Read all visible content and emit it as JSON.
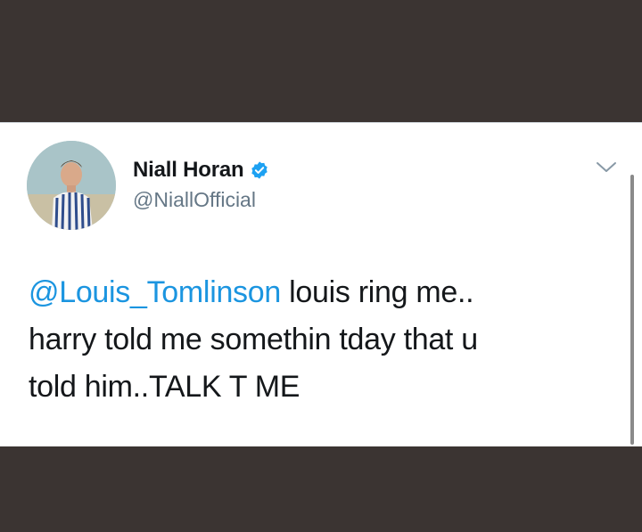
{
  "user": {
    "display_name": "Niall Horan",
    "handle": "@NiallOfficial",
    "verified": true
  },
  "tweet": {
    "mention": "@Louis_Tomlinson",
    "line1_rest": " louis ring me..",
    "line2": "harry told me somethin tday that u",
    "line3": "told him..TALK T ME"
  },
  "colors": {
    "mention": "#1b95e0",
    "verified_badge": "#1da1f2",
    "background_bar": "#3b3432"
  },
  "icons": {
    "menu": "chevron-down-icon",
    "verified": "verified-badge-icon"
  }
}
